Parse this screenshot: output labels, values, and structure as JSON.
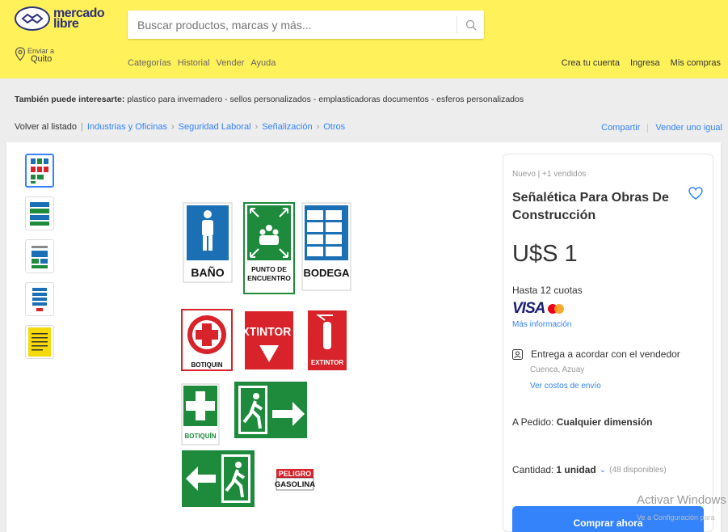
{
  "header": {
    "logo_line1": "mercado",
    "logo_line2": "libre",
    "search_placeholder": "Buscar productos, marcas y más...",
    "location_label": "Enviar a",
    "location_city": "Quito",
    "nav": [
      "Categorías",
      "Historial",
      "Vender",
      "Ayuda"
    ],
    "user_nav": [
      "Crea tu cuenta",
      "Ingresa",
      "Mis compras"
    ],
    "brand_yellow": "#fff159"
  },
  "interest": {
    "label": "También puede interesarte:",
    "items": "plastico para invernadero - sellos personalizados - emplasticadoras documentos - esferos personalizados"
  },
  "breadcrumb": {
    "back": "Volver al listado",
    "items": [
      "Industrias y Oficinas",
      "Seguridad Laboral",
      "Señalización",
      "Otros"
    ],
    "share": "Compartir",
    "sell_same": "Vender uno igual"
  },
  "image_signs": {
    "bano": "BAÑO",
    "punto": "PUNTO DE ENCUENTRO",
    "bodega": "BODEGA",
    "botiquin_red": "BOTIQUIN",
    "extintor_big": "EXTINTOR",
    "extintor_small": "EXTINTOR",
    "botiquin_green": "BOTIQUÍN",
    "peligro": "PELIGRO",
    "gasolina": "GASOLINA"
  },
  "product": {
    "condition": "Nuevo  |  +1 vendidos",
    "title": "Señalética Para Obras De Construcción",
    "price": "U$S 1",
    "installments": "Hasta 12 cuotas",
    "visa": "VISA",
    "more_info": "Más información",
    "delivery": "Entrega a acordar con el vendedor",
    "city": "Cuenca, Azuay",
    "shipping_costs": "Ver costos de envío",
    "order_label": "A Pedido:",
    "order_value": "Cualquier dimensión",
    "quantity_label": "Cantidad:",
    "quantity_value": "1 unidad",
    "available": "(48 disponibles)",
    "buy_button": "Comprar ahora",
    "accent": "#3483fa"
  },
  "watermark": {
    "title": "Activar Windows",
    "subtitle": "Ve a Configuración para"
  }
}
